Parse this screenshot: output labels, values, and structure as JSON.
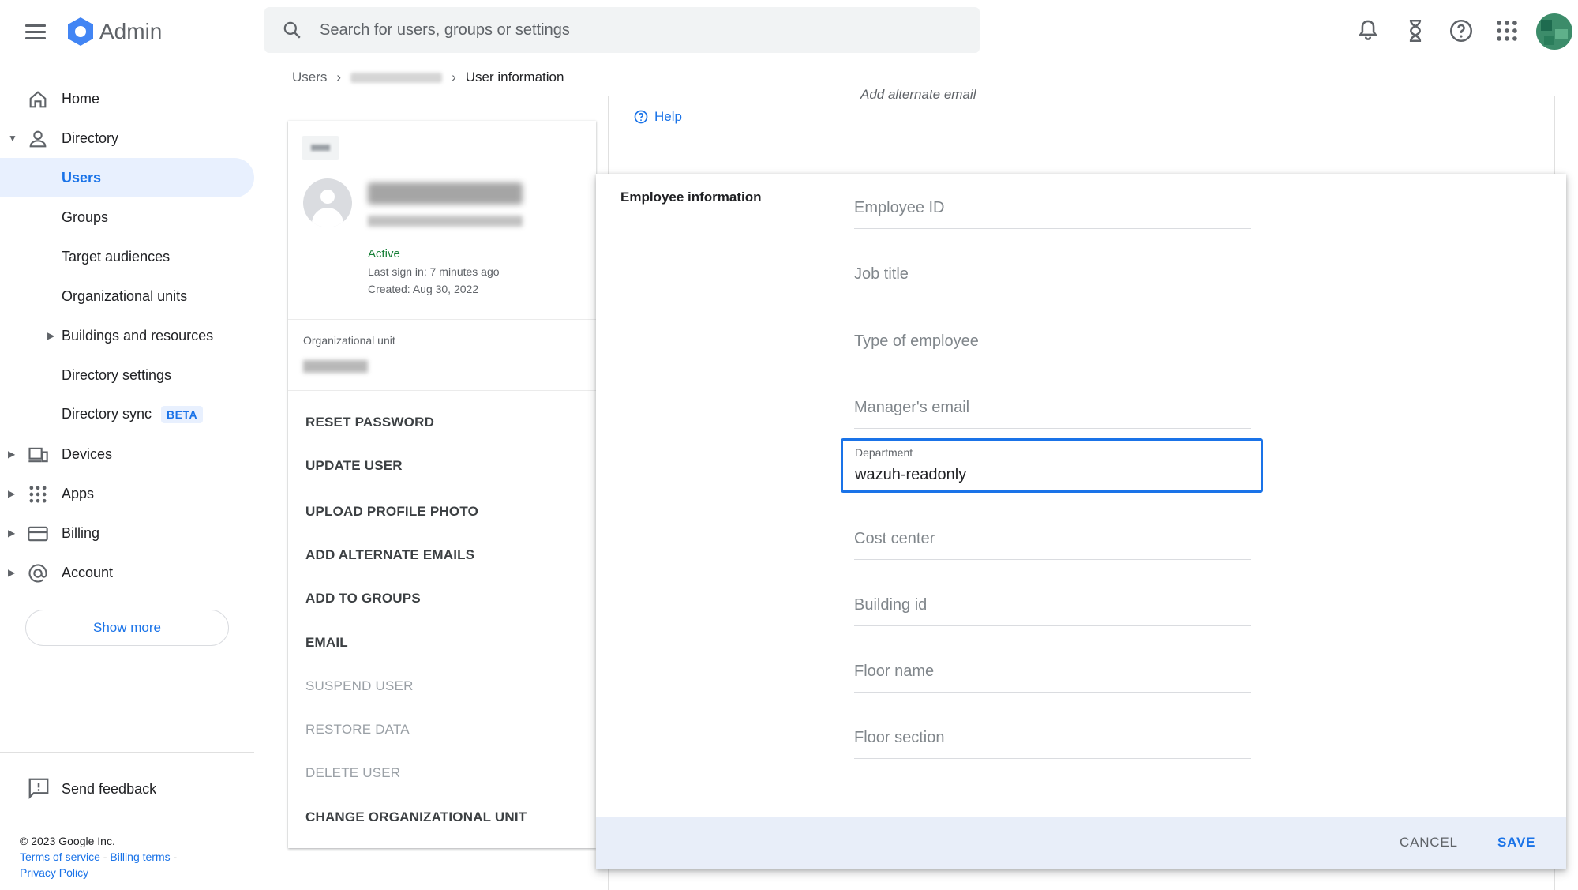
{
  "app": {
    "title": "Admin"
  },
  "search": {
    "placeholder": "Search for users, groups or settings"
  },
  "header_icons": [
    "bell-icon",
    "hourglass-icon",
    "help-circle-icon",
    "apps-grid-icon"
  ],
  "breadcrumb": {
    "root": "Users",
    "current": "User information"
  },
  "sidebar": {
    "items": [
      {
        "label": "Home",
        "icon": "home-icon"
      },
      {
        "label": "Directory",
        "icon": "person-icon"
      },
      {
        "label": "Users"
      },
      {
        "label": "Groups"
      },
      {
        "label": "Target audiences"
      },
      {
        "label": "Organizational units"
      },
      {
        "label": "Buildings and resources"
      },
      {
        "label": "Directory settings"
      },
      {
        "label": "Directory sync",
        "badge": "BETA"
      },
      {
        "label": "Devices",
        "icon": "devices-icon"
      },
      {
        "label": "Apps",
        "icon": "apps-icon"
      },
      {
        "label": "Billing",
        "icon": "credit-card-icon"
      },
      {
        "label": "Account",
        "icon": "at-sign-icon"
      }
    ],
    "show_more": "Show more",
    "feedback": "Send feedback"
  },
  "footer": {
    "copyright": "© 2023 Google Inc.",
    "terms": "Terms of service",
    "billing_terms": "Billing terms",
    "privacy": "Privacy Policy"
  },
  "user_card": {
    "status": "Active",
    "last_sign_in": "Last sign in: 7 minutes ago",
    "created": "Created: Aug 30, 2022",
    "org_unit_label": "Organizational unit",
    "actions": [
      "RESET PASSWORD",
      "UPDATE USER",
      "UPLOAD PROFILE PHOTO",
      "ADD ALTERNATE EMAILS",
      "ADD TO GROUPS",
      "EMAIL",
      "SUSPEND USER",
      "RESTORE DATA",
      "DELETE USER",
      "CHANGE ORGANIZATIONAL UNIT"
    ]
  },
  "background": {
    "alternate_email_hint": "Add alternate email",
    "help": "Help"
  },
  "dialog": {
    "title": "Employee information",
    "fields": {
      "employee_id": "Employee ID",
      "job_title": "Job title",
      "type_of_employee": "Type of employee",
      "managers_email": "Manager's email",
      "department_label": "Department",
      "department_value": "wazuh-readonly",
      "cost_center": "Cost center",
      "building_id": "Building id",
      "floor_name": "Floor name",
      "floor_section": "Floor section"
    },
    "cancel": "CANCEL",
    "save": "SAVE"
  }
}
